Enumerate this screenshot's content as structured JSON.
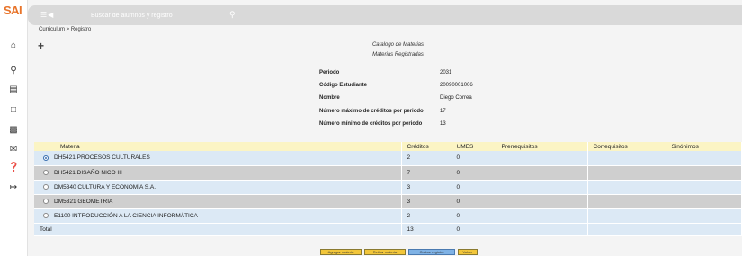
{
  "app": {
    "logo": "SAI"
  },
  "search": {
    "placeholder": "Buscar de alumnos y registro"
  },
  "breadcrumb": "Curriculum > Registro",
  "titles": {
    "line1": "Catalogo de Materias",
    "line2": "Materias Registradas"
  },
  "student_info": {
    "rows": [
      {
        "label": "Periodo",
        "value": "2031"
      },
      {
        "label": "Código Estudiante",
        "value": "20090001006"
      },
      {
        "label": "Nombre",
        "value": "Diego Correa"
      },
      {
        "label": "Número máximo de créditos por periodo",
        "value": "17"
      },
      {
        "label": "Número mínimo de créditos por periodo",
        "value": "13"
      }
    ]
  },
  "table": {
    "headers": [
      "Materia",
      "Créditos",
      "UMES",
      "Prerrequisitos",
      "Correquisitos",
      "Sinónimos"
    ],
    "rows": [
      {
        "materia": "DH5421 PROCESOS CULTURALES",
        "creditos": "2",
        "umes": "0",
        "selected": true
      },
      {
        "materia": "DH5421 DISAÑO NICO III",
        "creditos": "7",
        "umes": "0",
        "selected": false
      },
      {
        "materia": "DM5340 CULTURA Y ECONOMÍA S.A.",
        "creditos": "3",
        "umes": "0",
        "selected": false
      },
      {
        "materia": "DM5321 GEOMETRIA",
        "creditos": "3",
        "umes": "0",
        "selected": false
      },
      {
        "materia": "E1100 INTRODUCCIÓN A LA CIENCIA INFORMÁTICA",
        "creditos": "2",
        "umes": "0",
        "selected": false
      }
    ],
    "total_label": "Total",
    "total_creditos": "13",
    "total_umes": "0"
  },
  "buttons": {
    "b1": "Agregar materia",
    "b2": "Retirar materia",
    "b3": "Grabar registro",
    "b4": "Volver"
  },
  "colors": {
    "accent_logo": "#e8742a",
    "header_yellow": "#fbf4c4",
    "row_blue": "#dce9f5",
    "row_gray": "#cfcfcf",
    "button_yellow": "#f2c63a",
    "button_blue": "#7fb2e5"
  }
}
